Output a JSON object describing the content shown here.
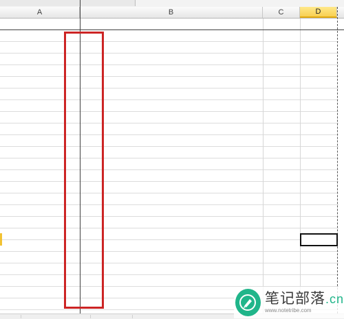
{
  "columns": [
    {
      "id": "A",
      "label": "A"
    },
    {
      "id": "B",
      "label": "B"
    },
    {
      "id": "C",
      "label": "C"
    },
    {
      "id": "D",
      "label": "D",
      "selected": true
    }
  ],
  "active_cell": {
    "column": "D"
  },
  "colors": {
    "highlight_box": "#cc2424",
    "selected_header": "#f8cf52",
    "watermark_brand": "#20b58a"
  },
  "watermark": {
    "title": "笔记部落",
    "suffix": ".cn",
    "url": "www.notetribe.com",
    "icon": "pencil-icon"
  }
}
